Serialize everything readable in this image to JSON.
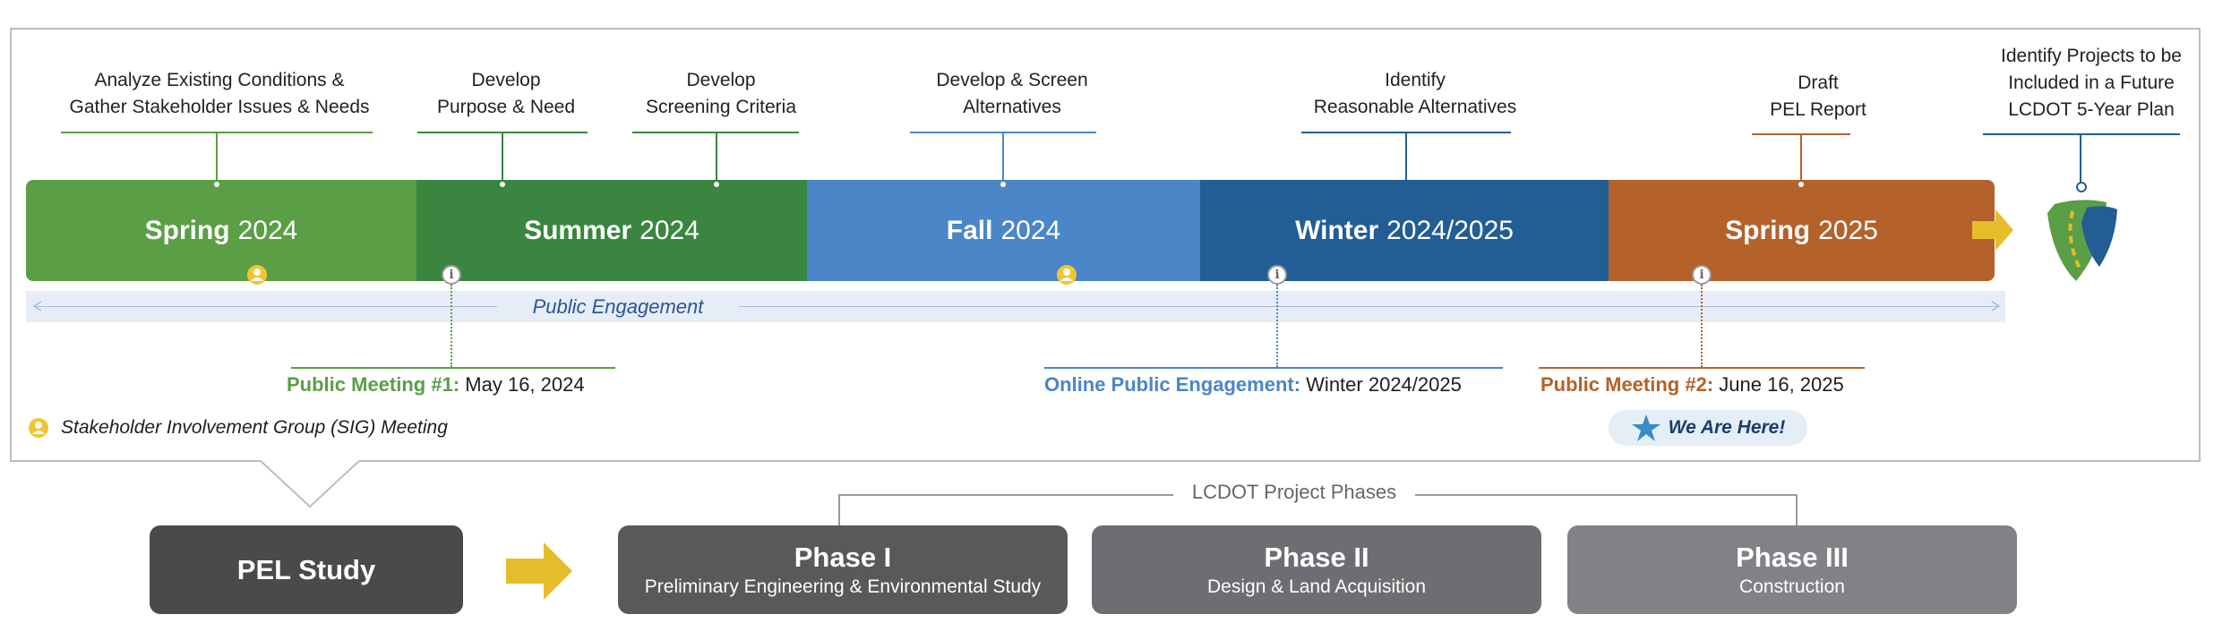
{
  "tasks": [
    {
      "line1": "Analyze Existing Conditions &",
      "line2": "Gather Stakeholder Issues & Needs"
    },
    {
      "line1": "Develop",
      "line2": "Purpose & Need"
    },
    {
      "line1": "Develop",
      "line2": "Screening Criteria"
    },
    {
      "line1": "Develop & Screen",
      "line2": "Alternatives"
    },
    {
      "line1": "Identify",
      "line2": "Reasonable Alternatives"
    },
    {
      "line1": "Draft",
      "line2": "PEL Report"
    },
    {
      "line1": "Identify Projects to be",
      "line2": "Included in a Future",
      "line3": "LCDOT 5-Year Plan"
    }
  ],
  "seasons": [
    {
      "name": "Spring",
      "year": "2024",
      "color": "#5a9e45"
    },
    {
      "name": "Summer",
      "year": "2024",
      "color": "#3a8640"
    },
    {
      "name": "Fall",
      "year": "2024",
      "color": "#4a86c8"
    },
    {
      "name": "Winter",
      "year": "2024/2025",
      "color": "#225d94"
    },
    {
      "name": "Spring",
      "year": "2025",
      "color": "#b5612a"
    }
  ],
  "engagement": {
    "label": "Public Engagement"
  },
  "meetings": [
    {
      "title": "Public Meeting #1:",
      "date": "May 16, 2024",
      "color": "#5a9e45"
    },
    {
      "title": "Online Public Engagement:",
      "date": "Winter 2024/2025",
      "color": "#4a86c8"
    },
    {
      "title": "Public Meeting #2:",
      "date": "June 16, 2025",
      "color": "#b5612a"
    }
  ],
  "legend": {
    "sig_label": "Stakeholder Involvement Group (SIG) Meeting"
  },
  "status": {
    "we_are_here": "We Are Here!"
  },
  "pel_study": {
    "label": "PEL Study"
  },
  "phases_header": "LCDOT Project Phases",
  "phases": [
    {
      "title": "Phase I",
      "subtitle": "Preliminary Engineering & Environmental Study",
      "color": "#58595b"
    },
    {
      "title": "Phase II",
      "subtitle": "Design & Land Acquisition",
      "color": "#6d6e71"
    },
    {
      "title": "Phase III",
      "subtitle": "Construction",
      "color": "#808285"
    }
  ],
  "colors": {
    "arrow": "#e5bd2a",
    "sig_icon": "#f2c530",
    "star": "#3a8cc4"
  },
  "icons": [
    "sig-person-icon",
    "info-icon",
    "star-icon",
    "arrow-right-icon",
    "road-shield-icon"
  ]
}
